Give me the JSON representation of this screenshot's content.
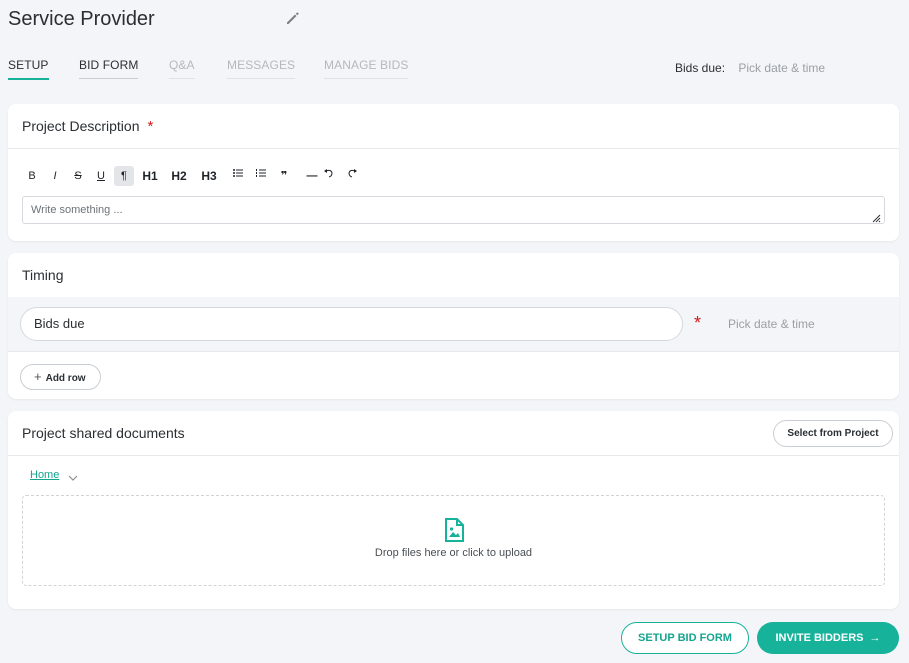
{
  "header": {
    "title": "Service Provider",
    "edit_icon": "pencil-icon"
  },
  "tabs": [
    {
      "label": "SETUP",
      "state": "active"
    },
    {
      "label": "BID FORM",
      "state": "enabled"
    },
    {
      "label": "Q&A",
      "state": "disabled"
    },
    {
      "label": "MESSAGES",
      "state": "disabled"
    },
    {
      "label": "MANAGE BIDS",
      "state": "disabled"
    }
  ],
  "bids_due_header": {
    "label": "Bids due:",
    "value": "Pick date & time"
  },
  "project_description": {
    "title": "Project Description",
    "required_mark": "*",
    "toolbar": {
      "bold": "B",
      "italic": "I",
      "strike": "S",
      "underline": "U",
      "paragraph": "¶",
      "h1": "H1",
      "h2": "H2",
      "h3": "H3",
      "bullet_list_icon": "bullet-list-icon",
      "ordered_list_icon": "ordered-list-icon",
      "quote": "❞",
      "hr": "—",
      "undo_icon": "undo-icon",
      "redo_icon": "redo-icon"
    },
    "editor_placeholder": "Write something ..."
  },
  "timing": {
    "title": "Timing",
    "row_label": "Bids due",
    "required_mark": "*",
    "date_value": "Pick date & time",
    "add_row_label": "Add row"
  },
  "documents": {
    "title": "Project shared documents",
    "select_button": "Select from Project",
    "breadcrumb": "Home",
    "drop_text": "Drop files here or click to upload",
    "upload_icon": "image-file-icon"
  },
  "footer": {
    "setup_bid_form": "SETUP BID FORM",
    "invite_bidders": "INVITE BIDDERS",
    "arrow": "→"
  },
  "colors": {
    "accent": "#16b39a",
    "required": "#d01a1a",
    "background": "#f3f5f8"
  }
}
